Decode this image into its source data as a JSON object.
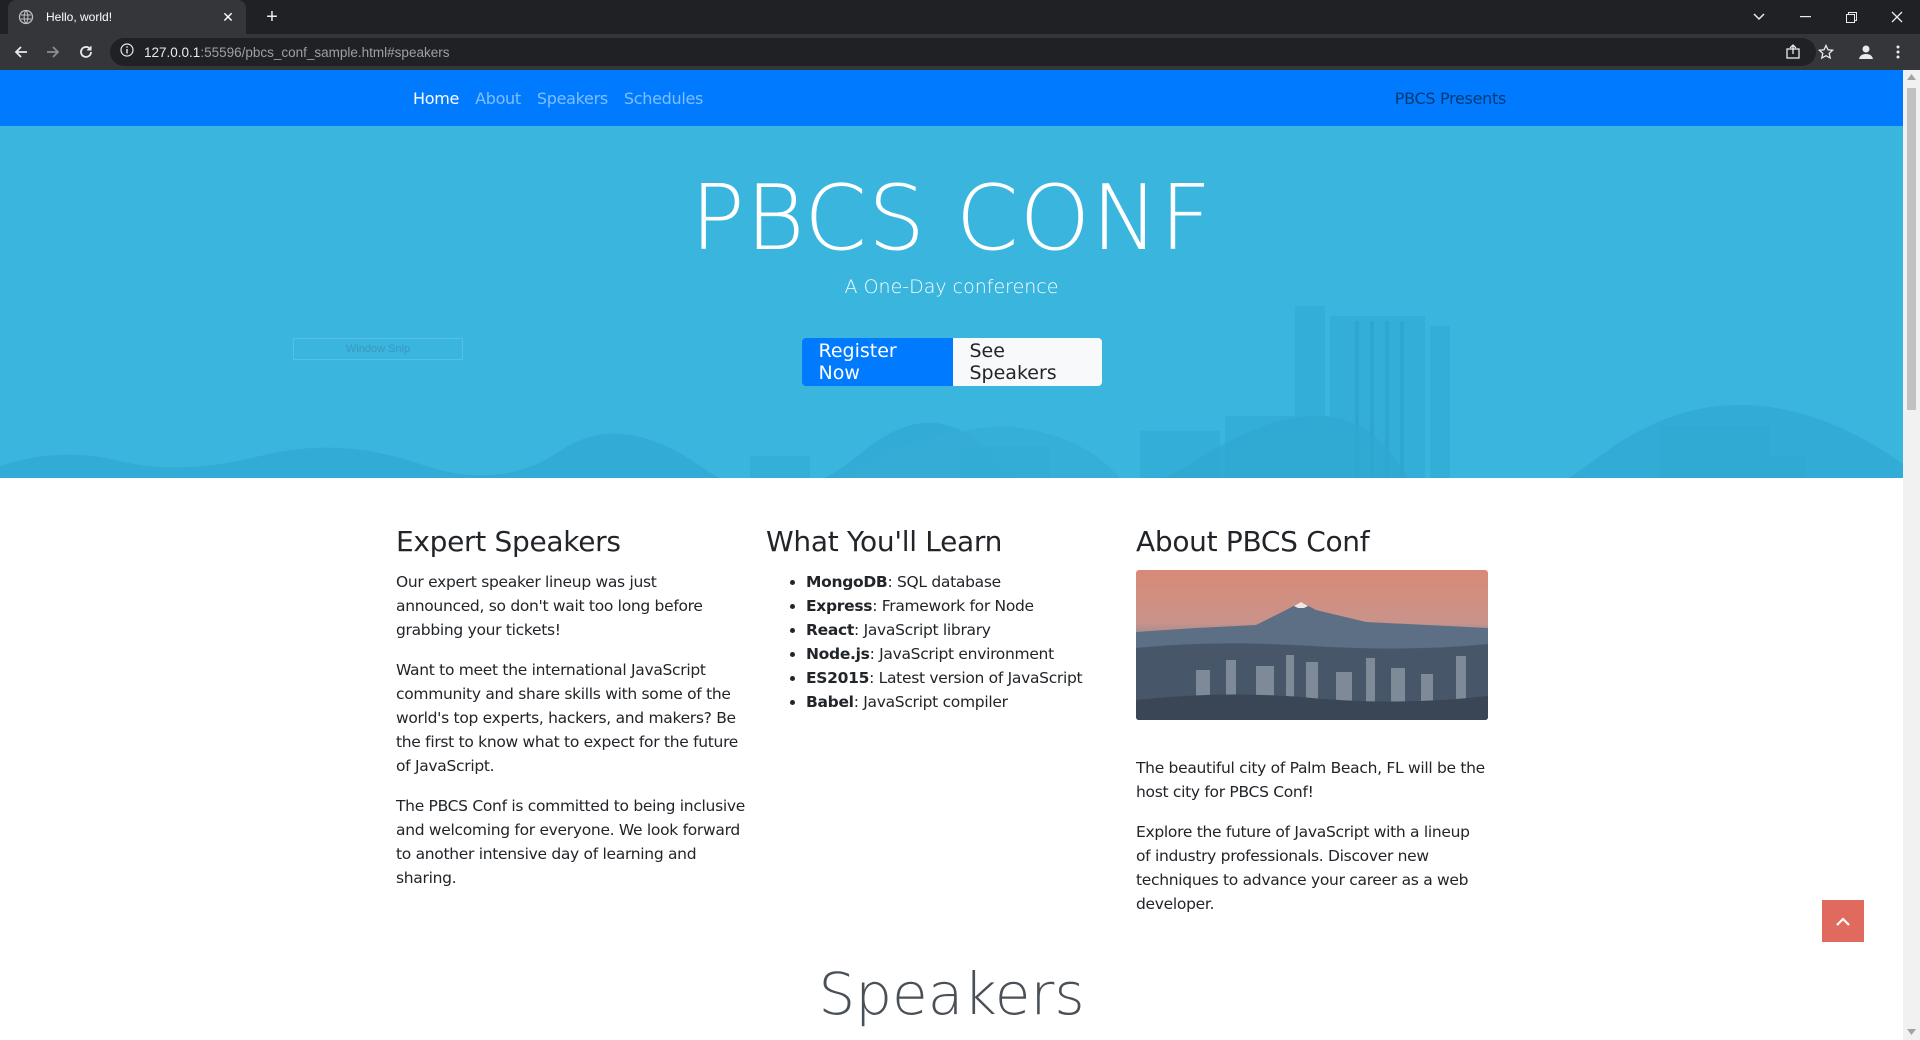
{
  "browser": {
    "tab_title": "Hello, world!",
    "tab_close": "✕",
    "new_tab": "+",
    "url_host": "127.0.0.1",
    "url_rest": ":55596/pbcs_conf_sample.html#speakers"
  },
  "nav": {
    "links": [
      "Home",
      "About",
      "Speakers",
      "Schedules"
    ],
    "brand": "PBCS Presents"
  },
  "hero": {
    "title": "PBCS CONF",
    "subtitle": "A One-Day conference",
    "register_label": "Register Now",
    "see_speakers_label": "See Speakers",
    "watermark": "Window Snip"
  },
  "features": {
    "speakers": {
      "heading": "Expert Speakers",
      "paragraphs": [
        "Our expert speaker lineup was just announced, so don't wait too long before grabbing your tickets!",
        "Want to meet the international JavaScript community and share skills with some of the world's top experts, hackers, and makers? Be the first to know what to expect for the future of JavaScript.",
        "The PBCS Conf is committed to being inclusive and welcoming for everyone. We look forward to another intensive day of learning and sharing."
      ]
    },
    "learn": {
      "heading": "What You'll Learn",
      "items": [
        {
          "term": "MongoDB",
          "desc": ": SQL database"
        },
        {
          "term": "Express",
          "desc": ": Framework for Node"
        },
        {
          "term": "React",
          "desc": ": JavaScript library"
        },
        {
          "term": "Node.js",
          "desc": ": JavaScript environment"
        },
        {
          "term": "ES2015",
          "desc": ": Latest version of JavaScript"
        },
        {
          "term": "Babel",
          "desc": ": JavaScript compiler"
        }
      ]
    },
    "about": {
      "heading": "About PBCS Conf",
      "paragraphs": [
        "The beautiful city of Palm Beach, FL will be the host city for PBCS Conf!",
        "Explore the future of JavaScript with a lineup of industry professionals. Discover new techniques to advance your career as a web developer."
      ]
    }
  },
  "speakers_section": {
    "heading": "Speakers"
  },
  "colors": {
    "navbar": "#007bff",
    "hero": "#39b5de",
    "to_top": "#e16a5f"
  }
}
